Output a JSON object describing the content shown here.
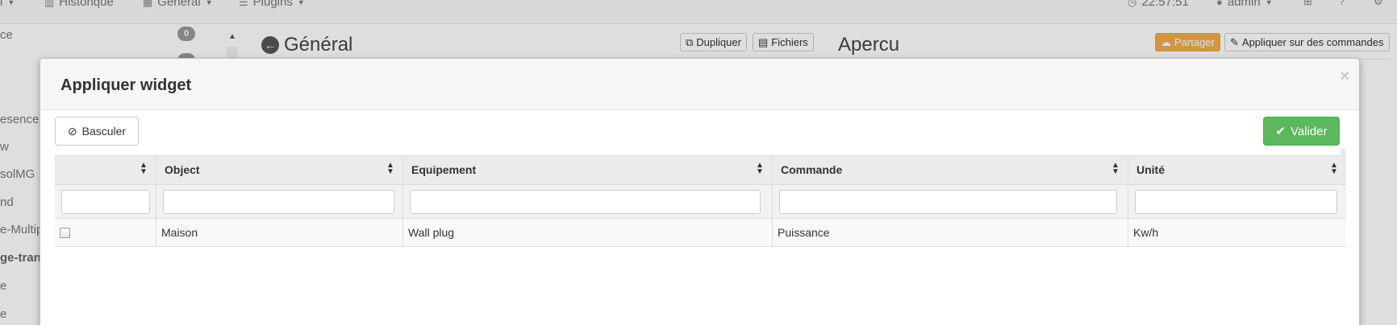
{
  "navbar": {
    "partial_left_label": "l",
    "history_label": "Historique",
    "general_label": "Général",
    "plugins_label": "Plugins",
    "clock": "22:57:51",
    "user": "admin"
  },
  "sidebar": {
    "badge_count": "0",
    "items": [
      {
        "label": "ce"
      },
      {
        "label": "esence"
      },
      {
        "label": "w"
      },
      {
        "label": "solMG"
      },
      {
        "label": "nd"
      },
      {
        "label": "e-Multip"
      },
      {
        "label": "ge-trans"
      },
      {
        "label": "e"
      },
      {
        "label": "e"
      }
    ]
  },
  "page": {
    "title": "Général",
    "duplicate_label": "Dupliquer",
    "files_label": "Fichiers",
    "preview_title": "Apercu",
    "share_label": "Partager",
    "apply_commands_label": "Appliquer sur des commandes"
  },
  "modal": {
    "title": "Appliquer widget",
    "close_glyph": "×",
    "toggle_label": "Basculer",
    "validate_label": "Valider",
    "columns": [
      "",
      "Object",
      "Equipement",
      "Commande",
      "Unité"
    ],
    "rows": [
      {
        "object": "Maison",
        "equipment": "Wall plug",
        "command": "Puissance",
        "unit": "Kw/h"
      }
    ]
  },
  "colors": {
    "success": "#5cb85c",
    "warning": "#f0ad4e"
  }
}
